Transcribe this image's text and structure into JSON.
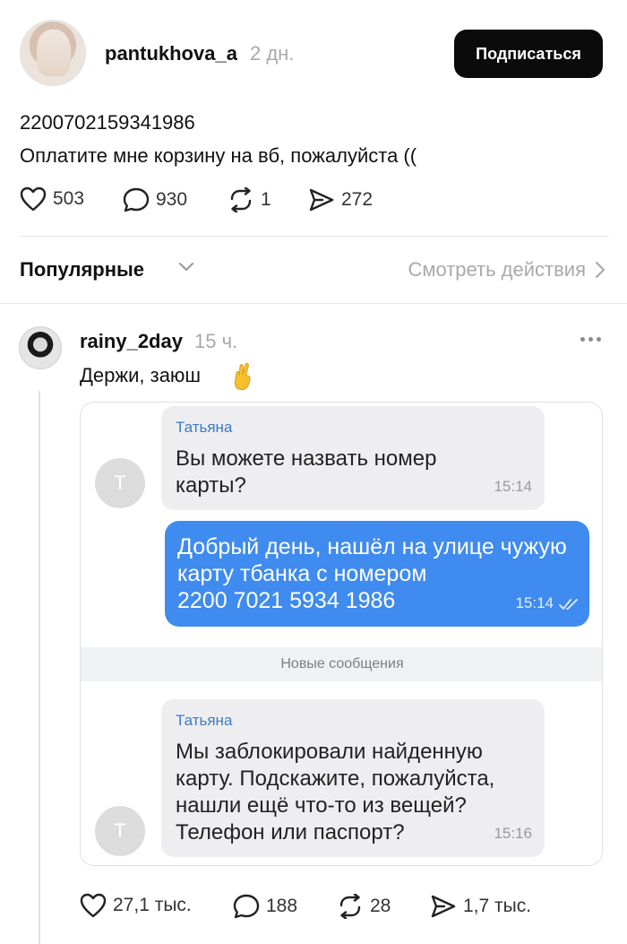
{
  "post": {
    "username": "pantukhova_a",
    "time": "2 дн.",
    "follow_label": "Подписаться",
    "text_lines": [
      "2200702159341986",
      "Оплатите мне корзину на вб, пожалуйста (("
    ],
    "stats": {
      "likes": "503",
      "comments": "930",
      "reposts": "1",
      "shares": "272"
    }
  },
  "sort": {
    "label": "Популярные",
    "view_actions": "Смотреть действия"
  },
  "comment": {
    "username": "rainy_2day",
    "time": "15 ч.",
    "text": "Держи, заюш",
    "stats": {
      "likes": "27,1 тыс.",
      "comments": "188",
      "reposts": "28",
      "shares": "1,7 тыс."
    },
    "screenshot": {
      "avatar_letter": "Т",
      "msg1": {
        "sender": "Татьяна",
        "lines": [
          "Вы можете назвать номер",
          "карты?"
        ],
        "time": "15:14"
      },
      "msg2": {
        "lines": [
          "Добрый день, нашёл на улице чужую",
          "карту тбанка с номером",
          "2200 7021 5934 1986"
        ],
        "time": "15:14"
      },
      "divider": "Новые сообщения",
      "msg3": {
        "sender": "Татьяна",
        "lines": [
          "Мы заблокировали найденную",
          "карту. Подскажите, пожалуйста,",
          "нашли ещё что-то из вещей?",
          "Телефон или паспорт?"
        ],
        "time": "15:16"
      }
    }
  },
  "colors": {
    "accent_blue": "#3f8bef",
    "sender_blue": "#3c7bc5",
    "muted": "#a9a9a9"
  },
  "icons": [
    "heart-icon",
    "comment-icon",
    "repost-icon",
    "share-icon",
    "chevron-down-icon",
    "chevron-right-icon",
    "more-icon",
    "crossed-fingers-emoji",
    "double-check-icon"
  ]
}
